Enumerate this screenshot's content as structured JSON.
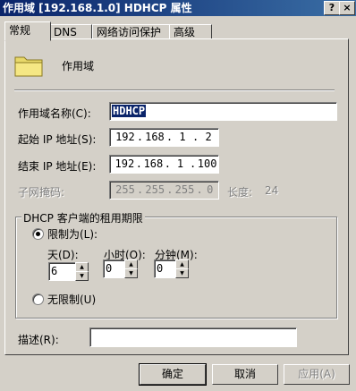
{
  "window": {
    "title": "作用域 [192.168.1.0] HDHCP 属性",
    "help_glyph": "?",
    "close_glyph": "×"
  },
  "tabs": [
    {
      "label": "常规",
      "active": true
    },
    {
      "label": "DNS"
    },
    {
      "label": "网络访问保护"
    },
    {
      "label": "高级"
    }
  ],
  "header": {
    "icon": "folder-icon",
    "label": "作用域"
  },
  "form": {
    "scope_name_label": "作用域名称(C):",
    "scope_name_value": "HDHCP",
    "start_ip_label": "起始 IP 地址(S):",
    "start_ip": [
      "192",
      "168",
      "1",
      "2"
    ],
    "end_ip_label": "结束 IP 地址(E):",
    "end_ip": [
      "192",
      "168",
      "1",
      "100"
    ],
    "subnet_label": "子网掩码:",
    "subnet": [
      "255",
      "255",
      "255",
      "0"
    ],
    "length_label": "长度:",
    "length_value": "24"
  },
  "lease": {
    "group_title": "DHCP 客户端的租用期限",
    "limited_label": "限制为(L):",
    "days_label": "天(D):",
    "days_value": "6",
    "hours_label": "小时(O):",
    "hours_value": "0",
    "minutes_label": "分钟(M):",
    "minutes_value": "0",
    "unlimited_label": "无限制(U)",
    "selected": "limited"
  },
  "description": {
    "label": "描述(R):",
    "value": ""
  },
  "buttons": {
    "ok": "确定",
    "cancel": "取消",
    "apply": "应用(A)"
  },
  "colors": {
    "titlebar_start": "#0a246a",
    "titlebar_end": "#3a6ea5",
    "face": "#d4d0c8",
    "selection": "#0a246a"
  }
}
